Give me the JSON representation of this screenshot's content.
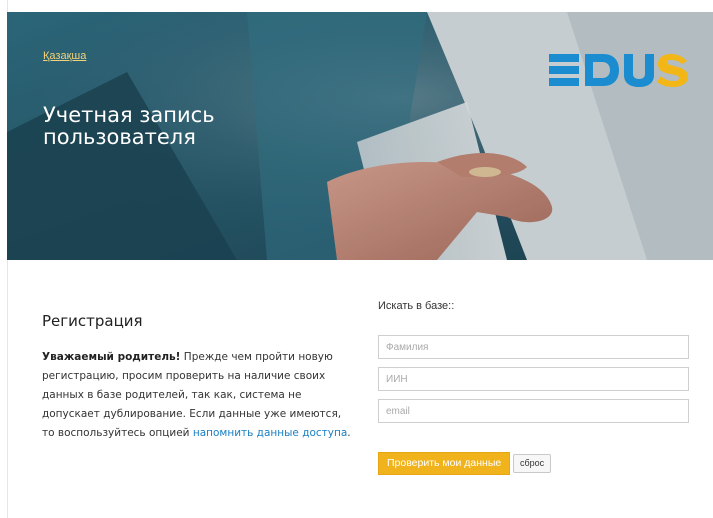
{
  "header": {
    "language_link": "Қазақша",
    "title_line1": "Учетная запись",
    "title_line2": "пользователя",
    "logo_text": "EDUS",
    "logo_colors": {
      "blue": "#1a8ccf",
      "yellow": "#f2b616"
    }
  },
  "registration": {
    "title": "Регистрация",
    "bold_intro": "Уважаемый родитель!",
    "text": " Прежде чем пройти новую регистрацию, просим проверить на наличие своих данных в базе родителей, так как, система не допускает дублирование. Если данные уже имеются, то воспользуйтесь опцией ",
    "link_text": "напомнить данные доступа",
    "text_end": "."
  },
  "search": {
    "label": "Искать в базе::",
    "fields": [
      {
        "placeholder": "Фамилия",
        "value": ""
      },
      {
        "placeholder": "ИИН",
        "value": ""
      },
      {
        "placeholder": "email",
        "value": ""
      }
    ],
    "check_button": "Проверить мои данные",
    "reset_button": "сброс"
  },
  "colors": {
    "accent": "#f1b31c",
    "link": "#1a7fc3",
    "hero_bg": "#2b5d70"
  }
}
